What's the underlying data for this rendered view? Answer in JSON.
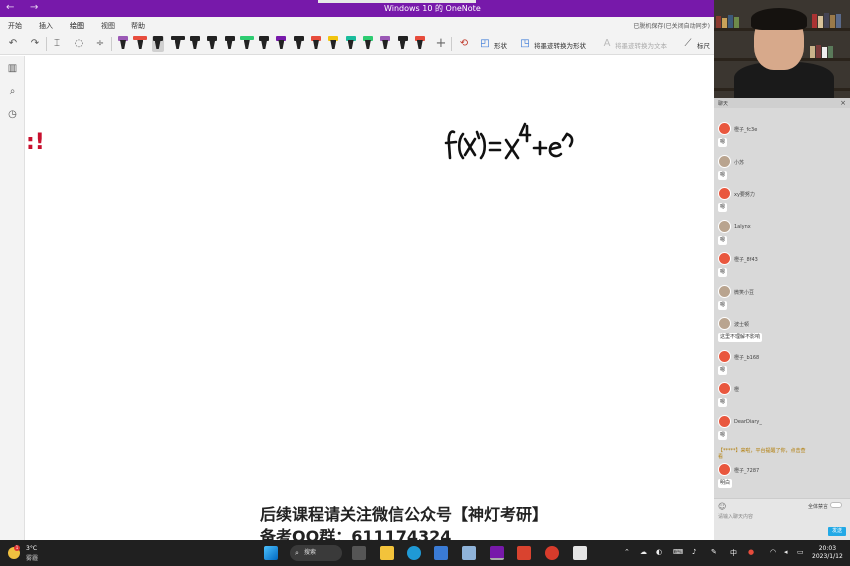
{
  "titlebar": {
    "title": "Windows 10 的 OneNote",
    "back_glyph": "←",
    "forward_glyph": "→"
  },
  "menu": {
    "tabs": [
      "开始",
      "插入",
      "绘图",
      "视图",
      "帮助"
    ],
    "active_tab": "绘图",
    "save_status": "已脱机保存(已关闭自动同步)"
  },
  "toolbar": {
    "undo_glyph": "↶",
    "redo_glyph": "↷",
    "shapes_label": "形状",
    "ink_to_shape_label": "将墨迹转换为形状",
    "ink_to_text_label": "将墨迹转换为文本",
    "ruler_label": "标尺",
    "add_pen_glyph": "+",
    "pen_colors": [
      "#9b59b6",
      "#e74c3c",
      "#222222",
      "#222222",
      "#222222",
      "#222222",
      "#222222",
      "#2ecc71",
      "#222222",
      "#7719aa",
      "#222222",
      "#e74c3c",
      "#f1c40f",
      "#1abc9c",
      "#2ecc71",
      "#9b59b6",
      "#222222",
      "#e74c3c"
    ]
  },
  "canvas": {
    "red_text": ":!",
    "formula": "f(x)=x⁴+e",
    "footer_line1": "后续课程请关注微信公众号【神灯考研】",
    "footer_line2": "备考QQ群：611174324"
  },
  "chat": {
    "header_left": "聊天",
    "messages": [
      {
        "name": "橙子_fc3e",
        "text": "嗯"
      },
      {
        "name": "小苏",
        "text": "嗯"
      },
      {
        "name": "xy要努力",
        "text": "嗯"
      },
      {
        "name": "1alynx",
        "text": "嗯"
      },
      {
        "name": "橙子_8f43",
        "text": "嗯"
      },
      {
        "name": "微笑小豆",
        "text": "嗯"
      },
      {
        "name": "波士顿",
        "text": "这里不理解不影响"
      },
      {
        "name": "橙子_b168",
        "text": "嗯"
      },
      {
        "name": "橙",
        "text": "嗯"
      },
      {
        "name": "DearDiary_",
        "text": "嗯"
      },
      {
        "name": "橙子_7287",
        "text": "明白"
      }
    ],
    "system_notice": "【*****】来啦，平台提醒了你，点击查看",
    "toggle_label": "全体禁言",
    "input_placeholder": "请输入聊天内容",
    "send_label": "发送"
  },
  "taskbar": {
    "temp": "3°C",
    "condition": "雾霾",
    "search_label": "搜索",
    "ime": "中",
    "time": "20:03",
    "date": "2023/1/12"
  }
}
